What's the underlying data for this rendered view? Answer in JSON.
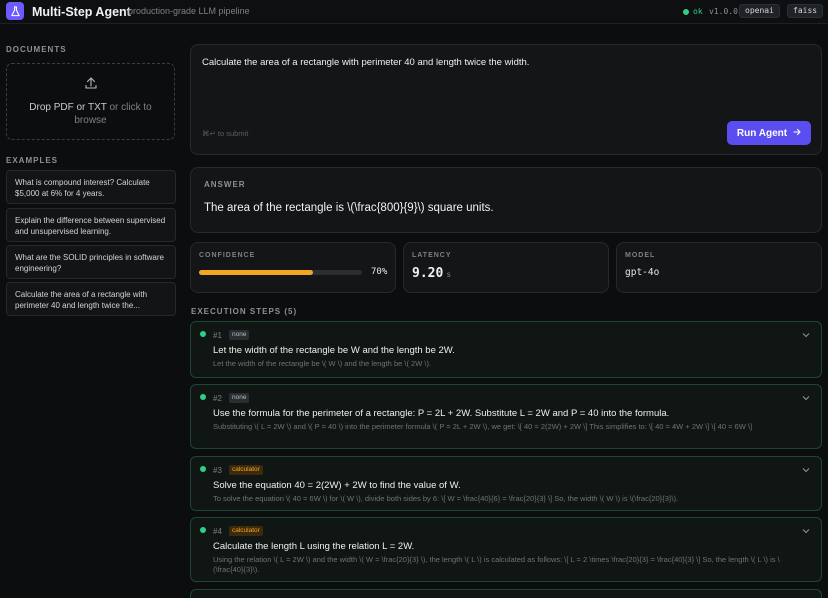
{
  "header": {
    "title": "Multi-Step Agent",
    "subtitle": "production-grade LLM pipeline",
    "status": "ok",
    "version": "v1.0.0",
    "tags": [
      "openai",
      "faiss"
    ],
    "accent": "#6b5bff"
  },
  "sidebar": {
    "documents_title": "DOCUMENTS",
    "drop_main": "Drop PDF or TXT",
    "drop_or": " or click to",
    "drop_end": "browse",
    "examples_title": "EXAMPLES",
    "examples": [
      "What is compound interest? Calculate $5,000 at 6% for 4 years.",
      "Explain the difference between supervised and unsupervised learning.",
      "What are the SOLID principles in software engineering?",
      "Calculate the area of a rectangle with perimeter 40 and length twice the..."
    ]
  },
  "prompt": {
    "text": "Calculate the area of a rectangle with perimeter 40 and length twice the width.",
    "hint": "⌘↵ to submit",
    "run_label": "Run Agent",
    "run_icon": "arrow-right-icon"
  },
  "answer": {
    "label": "ANSWER",
    "text": "The area of the rectangle is \\(\\frac{800}{9}\\) square units."
  },
  "metrics": {
    "confidence_label": "CONFIDENCE",
    "confidence_value": "70%",
    "confidence_fraction": 0.7,
    "confidence_color": "#f5a524",
    "latency_label": "LATENCY",
    "latency_value": "9.20",
    "latency_unit": "s",
    "model_label": "MODEL",
    "model_value": "gpt-4o"
  },
  "steps_title": "EXECUTION STEPS (5)",
  "steps": [
    {
      "num": "#1",
      "tool": "none",
      "title": "Let the width of the rectangle be W and the length be 2W.",
      "detail": "Let the width of the rectangle be \\( W \\) and the length be \\( 2W \\)."
    },
    {
      "num": "#2",
      "tool": "none",
      "title": "Use the formula for the perimeter of a rectangle: P = 2L + 2W. Substitute L = 2W and P = 40 into the formula.",
      "detail": "Substituting \\( L = 2W \\) and \\( P = 40 \\) into the perimeter formula \\( P = 2L + 2W \\), we get: \\[ 40 = 2(2W) + 2W \\] This simplifies to: \\[ 40 = 4W + 2W \\] \\[ 40 = 6W \\]"
    },
    {
      "num": "#3",
      "tool": "calculator",
      "title": "Solve the equation 40 = 2(2W) + 2W to find the value of W.",
      "detail": "To solve the equation \\( 40 = 6W \\) for \\( W \\), divide both sides by 6: \\[ W = \\frac{40}{6} = \\frac{20}{3} \\] So, the width \\( W \\) is \\(\\frac{20}{3}\\)."
    },
    {
      "num": "#4",
      "tool": "calculator",
      "title": "Calculate the length L using the relation L = 2W.",
      "detail": "Using the relation \\( L = 2W \\) and the width \\( W = \\frac{20}{3} \\), the length \\( L \\) is calculated as follows: \\[ L = 2 \\times \\frac{20}{3} = \\frac{40}{3} \\] So, the length \\( L \\) is \\(\\frac{40}{3}\\)."
    }
  ]
}
